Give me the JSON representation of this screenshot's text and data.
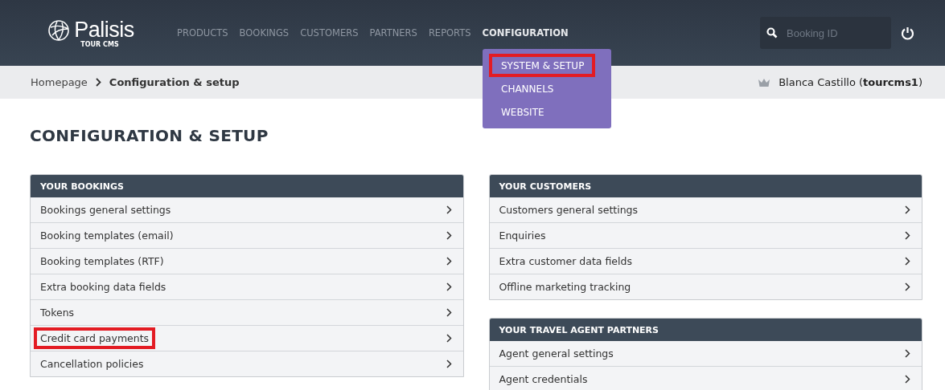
{
  "logo": {
    "name": "Palisis",
    "tagline": "TOUR CMS"
  },
  "nav": [
    {
      "label": "PRODUCTS",
      "selected": false
    },
    {
      "label": "BOOKINGS",
      "selected": false
    },
    {
      "label": "CUSTOMERS",
      "selected": false
    },
    {
      "label": "PARTNERS",
      "selected": false
    },
    {
      "label": "REPORTS",
      "selected": false
    },
    {
      "label": "CONFIGURATION",
      "selected": true
    }
  ],
  "dropdown": [
    {
      "label": "SYSTEM & SETUP",
      "highlighted": true
    },
    {
      "label": "CHANNELS",
      "highlighted": false
    },
    {
      "label": "WEBSITE",
      "highlighted": false
    }
  ],
  "search": {
    "placeholder": "Booking ID"
  },
  "breadcrumb": [
    "Homepage",
    "Configuration & setup"
  ],
  "user": {
    "text": "Blanca Castillo (**tourcms1**)"
  },
  "page_title": "CONFIGURATION & SETUP",
  "columns": [
    [
      {
        "title": "YOUR BOOKINGS",
        "items": [
          {
            "label": "Bookings general settings",
            "highlighted": false
          },
          {
            "label": "Booking templates (email)",
            "highlighted": false
          },
          {
            "label": "Booking templates (RTF)",
            "highlighted": false
          },
          {
            "label": "Extra booking data fields",
            "highlighted": false
          },
          {
            "label": "Tokens",
            "highlighted": false
          },
          {
            "label": "Credit card payments",
            "highlighted": true
          },
          {
            "label": "Cancellation policies",
            "highlighted": false
          }
        ]
      }
    ],
    [
      {
        "title": "YOUR CUSTOMERS",
        "items": [
          {
            "label": "Customers general settings",
            "highlighted": false
          },
          {
            "label": "Enquiries",
            "highlighted": false
          },
          {
            "label": "Extra customer data fields",
            "highlighted": false
          },
          {
            "label": "Offline marketing tracking",
            "highlighted": false
          }
        ]
      },
      {
        "title": "YOUR TRAVEL AGENT PARTNERS",
        "items": [
          {
            "label": "Agent general settings",
            "highlighted": false
          },
          {
            "label": "Agent credentials",
            "highlighted": false
          }
        ]
      }
    ]
  ]
}
